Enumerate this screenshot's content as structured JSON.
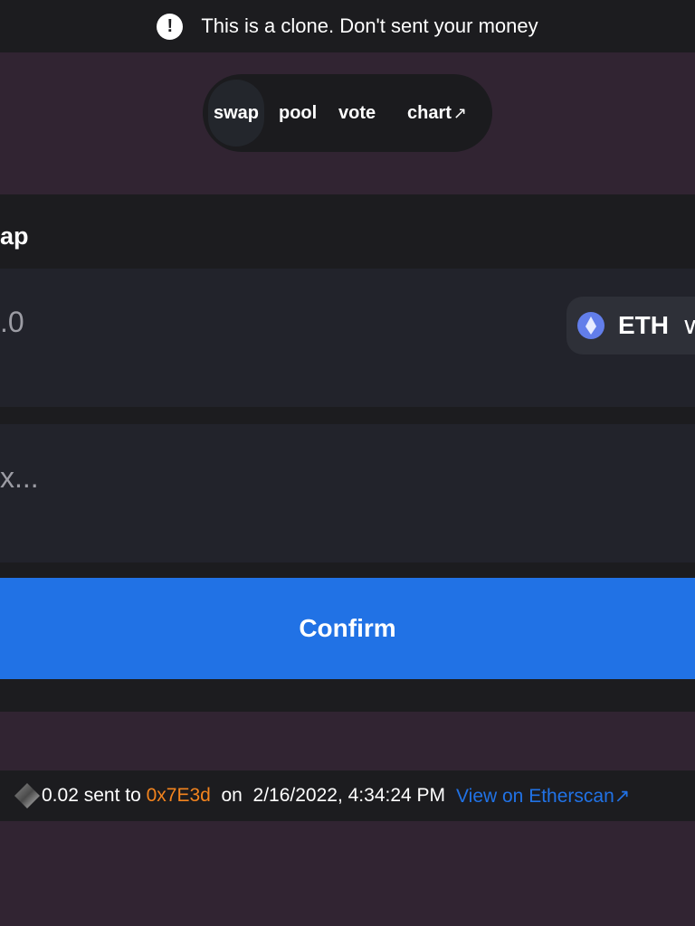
{
  "banner": {
    "icon": "exclamation-circle-icon",
    "text": "This is a clone. Don't sent your money"
  },
  "nav": {
    "items": [
      {
        "label": "swap",
        "active": true
      },
      {
        "label": "pool"
      },
      {
        "label": "vote"
      },
      {
        "label": "chart",
        "icon": "external-arrow-icon",
        "arrow": "↗"
      }
    ]
  },
  "swap": {
    "title": "ap",
    "amount": ".0",
    "token": {
      "symbol": "ETH",
      "icon": "eth-logo-icon",
      "chevron": "∨"
    },
    "address": "x...",
    "confirm_label": "Confirm"
  },
  "transaction": {
    "icon": "ethereum-diamond-icon",
    "amount_text": "0.02 sent to ",
    "address": "0x7E3d",
    "on_text": "  on  ",
    "timestamp": "2/16/2022, 4:34:24 PM",
    "link_label": "View on Etherscan",
    "link_arrow": "↗"
  },
  "colors": {
    "background": "#312432",
    "card": "#1c1c1f",
    "accent": "#2172e5",
    "address": "#f3841e"
  }
}
